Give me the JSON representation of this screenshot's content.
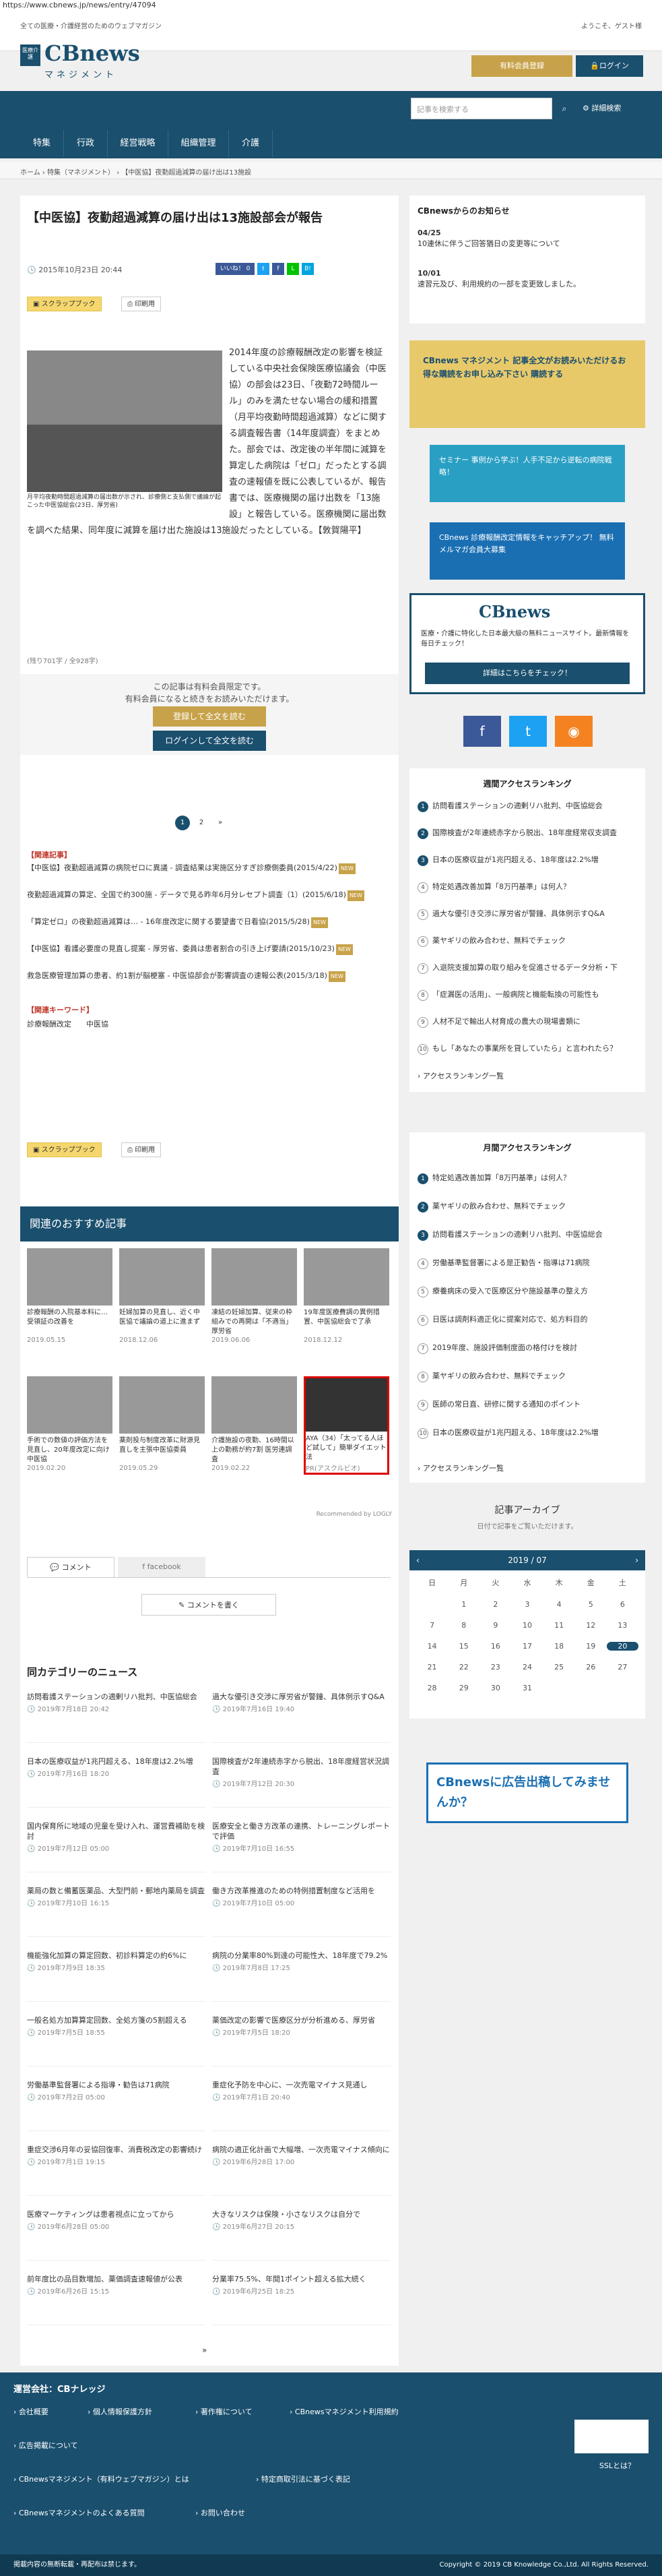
{
  "url": "https://www.cbnews.jp/news/entry/47094",
  "header": {
    "tagline": "全ての医療・介護経営のためのウェブマガジン",
    "welcome": "ようこそ、ゲスト様",
    "logo_box": "医療介護",
    "logo_cb": "CBnews",
    "logo_mg": "マネジメント",
    "register_label": "有料会員登録",
    "login_label": "ログイン"
  },
  "nav": {
    "items": [
      "特集",
      "行政",
      "経営戦略",
      "組織管理",
      "介護"
    ]
  },
  "search": {
    "placeholder": "記事を検索する",
    "advanced": "詳細検索"
  },
  "breadcrumb": "ホーム › 特集（マネジメント） › 【中医協】夜勤超過減算の届け出は13施設",
  "article": {
    "title": "【中医協】夜勤超過減算の届け出は13施設部会が報告",
    "date": "2015年10月23日 20:44",
    "share": {
      "like": "いいね！ 0",
      "tw": "t",
      "fb": "f",
      "line": "L",
      "hatena": "B!"
    },
    "scrap": "スクラップブック",
    "print": "印刷用",
    "caption": "月平均夜勤時間超過減算の届出数が示され、診療側と支払側で議論が起こった中医協総会(23日、厚労省)",
    "body": "2014年度の診療報酬改定の影響を検証している中央社会保険医療協議会（中医協）の部会は23日、「夜勤72時間ルール」のみを満たせない場合の緩和措置（月平均夜勤時間超過減算）などに関する調査報告書（14年度調査）をまとめた。部会では、改定後の半年間に減算を算定した病院は「ゼロ」だったとする調査の速報値を既に公表しているが、報告書では、医療機関の届け出数を「13施設」と報告している。医療機関に届出数を調べた結果、同年度に減算を届け出た施設は13施設だったとしている。【敦賀陽平】",
    "count": "(残り701字 / 全928字)",
    "paywall1": "この記事は有料会員限定です。",
    "paywall2": "有料会員になると続きをお読みいただけます。",
    "trial": "登録して全文を読む",
    "login_read": "ログインして全文を読む",
    "pages": [
      "1",
      "2",
      "»"
    ],
    "related_head": "【関連記事】",
    "related": [
      "【中医協】夜勤超過減算の病院ゼロに異議 - 調査結果は実施区分すぎ診療側委員(2015/4/22)",
      "夜勤超過減算の算定、全国で約300施 - データで見る昨年6月分レセプト調査（1）(2015/6/18)",
      "「算定ゼロ」の夜勤超過減算は… - 16年度改定に関する要望書で日看協(2015/5/28)",
      "【中医協】看護必要度の見直し提案 - 厚労省、委員は患者割合の引き上げ要請(2015/10/23)",
      "救急医療管理加算の患者、約1割が脳梗塞 - 中医協部会が影響調査の速報公表(2015/3/18)"
    ],
    "new_label": "NEW",
    "kw_head": "【関連キーワード】",
    "kw": [
      "診療報酬改定",
      "中医協"
    ]
  },
  "recommend": {
    "title": "関連のおすすめ記事",
    "row1": [
      {
        "t": "診療報酬の入院基本料に…　受領証の改善を",
        "d": "2019.05.15"
      },
      {
        "t": "妊婦加算の見直し、近く中医協で議論の道上に進まず",
        "d": "2018.12.06"
      },
      {
        "t": "凍結の妊婦加算、従来の枠組みでの再開は「不適当」厚労省",
        "d": "2019.06.06"
      },
      {
        "t": "19年度医療費調の異例措置、中医協総会で了承",
        "d": "2018.12.12"
      }
    ],
    "row2": [
      {
        "t": "手術での数値の評価方法を見直し、20年度改定に向け中医協",
        "d": "2019.02.20"
      },
      {
        "t": "薬剤投与制度改革に財源見直しを主張中医協委員",
        "d": "2019.05.29"
      },
      {
        "t": "介護施設の夜勤、16時間以上の勤務が約7割 医労連調査",
        "d": "2019.02.22"
      },
      {
        "t": "AYA（34）「太ってる人ほど試して」簡単ダイエット法",
        "d": "PR(アスクルビオ)"
      }
    ],
    "powered": "Recommended by LOGLY"
  },
  "comment": {
    "tab1": "コメント",
    "tab2": "facebook",
    "write": "コメントを書く"
  },
  "category": {
    "title": "同カテゴリーのニュース",
    "items": [
      {
        "t": "訪問看護ステーションの適剰リハ批判、中医協総会",
        "d": "2019年7月18日 20:42"
      },
      {
        "t": "過大な優引き交渉に厚労省が警鐘、具体例示すQ&A",
        "d": "2019年7月16日 19:40"
      },
      {
        "t": "日本の医療収益が1兆円超える、18年度は2.2%増",
        "d": "2019年7月16日 18:20"
      },
      {
        "t": "国際検査が2年連続赤字から脱出、18年度経営状況調査",
        "d": "2019年7月12日 20:30"
      },
      {
        "t": "国内保育所に地域の児童を受け入れ、運営費補助を検討",
        "d": "2019年7月12日 05:00"
      },
      {
        "t": "医療安全と働き方改革の連携、トレーニングレポートで評価",
        "d": "2019年7月10日 16:55"
      },
      {
        "t": "薬局の数と備蓄医薬品、大型門前・郵地内薬局を調査",
        "d": "2019年7月10日 16:15"
      },
      {
        "t": "働き方改革推進のための特例措置制度など活用を",
        "d": "2019年7月10日 05:00"
      },
      {
        "t": "機能強化加算の算定回数、初診料算定の約6%に",
        "d": "2019年7月9日 18:35"
      },
      {
        "t": "病院の分業率80%到達の可能性大、18年度で79.2%",
        "d": "2019年7月8日 17:25"
      },
      {
        "t": "一般名処方加算算定回数、全処方箋の5割超える",
        "d": "2019年7月5日 18:55"
      },
      {
        "t": "薬価改定の影響で医療区分が分析進める、厚労省",
        "d": "2019年7月5日 18:20"
      },
      {
        "t": "労働基準監督署による指導・勧告は71病院",
        "d": "2019年7月2日 05:00"
      },
      {
        "t": "重症化予防を中心に、一次売電マイナス見通し",
        "d": "2019年7月1日 20:40"
      },
      {
        "t": "重症交渉6月年の妥協回復率、消費税改定の影響続け",
        "d": "2019年7月1日 19:15"
      },
      {
        "t": "病院の適正化計画で大幅増、一次売電マイナス傾向に",
        "d": "2019年6月28日 17:00"
      },
      {
        "t": "医療マーケティングは患者視点に立ってから",
        "d": "2019年6月28日 05:00"
      },
      {
        "t": "大きなリスクは保険・小さなリスクは自分で",
        "d": "2019年6月27日 20:15"
      },
      {
        "t": "前年度比の品目数増加、薬価調査速報値が公表",
        "d": "2019年6月26日 15:15"
      },
      {
        "t": "分業率75.5%、年間1ポイント超える拡大続く",
        "d": "2019年6月25日 18:25"
      }
    ],
    "more": "»"
  },
  "sidebar": {
    "notice_title": "CBnewsからのお知らせ",
    "notices": [
      {
        "d": "04/25",
        "t": "10連休に伴うご回答猶日の変更等について"
      },
      {
        "d": "10/01",
        "t": "速習元及び、利用規約の一部を変更致しました。"
      }
    ],
    "banner1": "CBnews マネジメント 記事全文がお読みいただけるお得な購読をお申し込み下さい 購読する",
    "banner2": "セミナー 事例から学ぶ！人手不足から逆転の病院戦略！",
    "banner3": "CBnews 診療報酬改定情報をキャッチアップ！ 無料 メルマガ会員大募集",
    "banner4_title": "CBnews",
    "banner4_text": "医療・介護に特化した日本最大級の無料ニュースサイト。最新情報を毎日チェック！",
    "banner4_btn": "詳細はこちらをチェック！",
    "weekly_title": "週間アクセスランキング",
    "weekly": [
      "訪問看護ステーションの適剰リハ批判、中医協総会",
      "国際検査が2年連続赤字から脱出、18年度経常収支調査",
      "日本の医療収益が1兆円超える、18年度は2.2%増",
      "特定処遇改善加算「8万円基準」は何人？",
      "過大な優引き交渉に厚労省が警鐘、具体例示すQ&A",
      "薬ヤギリの飲み合わせ、無料でチェック",
      "入退院支援加算の取り組みを促進させるデータ分析・下",
      "「症漏医の活用」、一般病院と機能転換の可能性も",
      "人材不足で輸出人材育成の農大の現場書類に",
      "もし「あなたの事業所を貸していたら」と言われたら？"
    ],
    "ranking_more": "アクセスランキング一覧",
    "monthly_title": "月間アクセスランキング",
    "monthly": [
      "特定処遇改善加算「8万円基準」は何人？",
      "薬ヤギリの飲み合わせ、無料でチェック",
      "訪問看護ステーションの適剰リハ批判、中医協総会",
      "労働基準監督署による是正勧告・指導は71病院",
      "療養病床の受入で医療区分や施設基準の整え方",
      "日医は調剤料適正化に提案対応で、処方料目的",
      "2019年度、施設評価制度面の格付けを検討",
      "薬ヤギリの飲み合わせ、無料でチェック",
      "医師の常日直、研修に関する通知のポイント",
      "日本の医療収益が1兆円超える、18年度は2.2%増"
    ],
    "archive_title": "記事アーカイブ",
    "archive_sub": "日付で記事をご覧いただけます。",
    "cal_month": "2019 / 07",
    "cal_days": [
      "日",
      "月",
      "火",
      "水",
      "木",
      "金",
      "土",
      "",
      "1",
      "2",
      "3",
      "4",
      "5",
      "6",
      "7",
      "8",
      "9",
      "10",
      "11",
      "12",
      "13",
      "14",
      "15",
      "16",
      "17",
      "18",
      "19",
      "20",
      "21",
      "22",
      "23",
      "24",
      "25",
      "26",
      "27",
      "28",
      "29",
      "30",
      "31",
      "",
      ""
    ],
    "ad_text": "CBnewsに広告出稿してみませんか？"
  },
  "footer": {
    "title": "運営会社：CBナレッジ",
    "links": [
      "会社概要",
      "個人情報保護方針",
      "著作権について",
      "CBnewsマネジメント利用規約",
      "広告掲載について",
      "CBnewsマネジメント（有料ウェブマガジン）とは",
      "特定商取引法に基づく表記",
      "CBnewsマネジメントのよくある質問",
      "お問い合わせ"
    ],
    "ssl": "SSLとは？",
    "note": "掲載内容の無断転載・再配布は禁じます。",
    "copyright": "Copyright © 2019 CB Knowledge Co.,Ltd. All Rights Reserved."
  }
}
